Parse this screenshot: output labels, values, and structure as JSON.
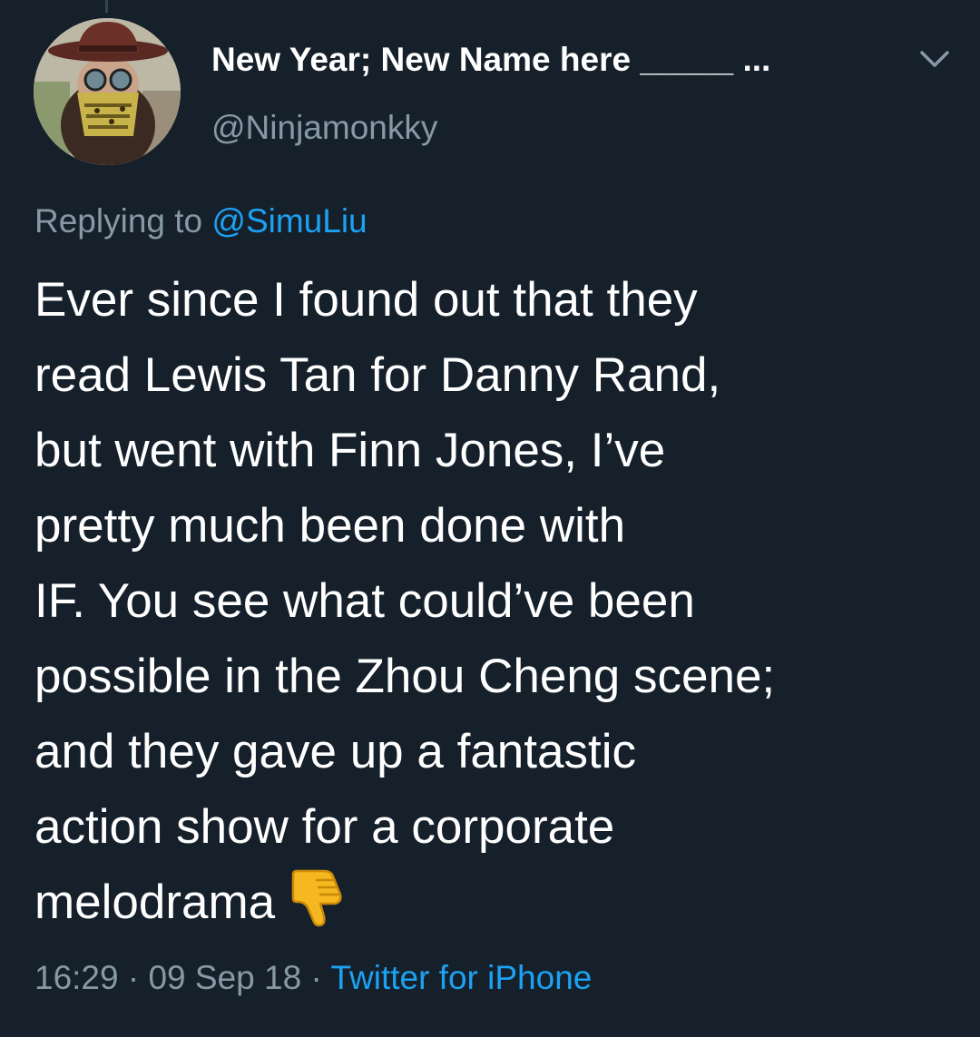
{
  "tweet": {
    "display_name": "New Year; New Name here _____ ...",
    "handle": "@Ninjamonkky",
    "replying_to_prefix": "Replying to",
    "replying_to_handle": "@SimuLiu",
    "body_lines": [
      "Ever since I found out that they",
      "read Lewis Tan for Danny Rand,",
      "but went with Finn Jones, I’ve",
      "pretty much been done with",
      "IF. You see what could’ve been",
      "possible in the Zhou Cheng scene;",
      "and they gave up a fantastic",
      "action show for a corporate",
      "melodrama"
    ],
    "emoji": "thumbs-down-icon",
    "time": "16:29",
    "separator": "·",
    "date": "09 Sep 18",
    "source": "Twitter for iPhone"
  },
  "colors": {
    "background": "#15202b",
    "primary_text": "#ffffff",
    "secondary_text": "#8899a6",
    "accent": "#1da1f2"
  }
}
